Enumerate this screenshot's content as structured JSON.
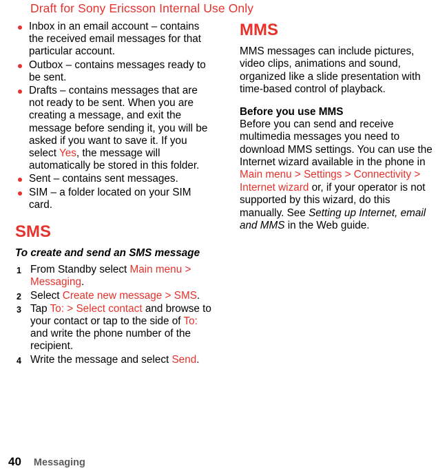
{
  "header": {
    "draft_notice": "Draft for Sony Ericsson Internal Use Only"
  },
  "left_column": {
    "bullets": [
      {
        "parts": [
          {
            "t": "Inbox in an email account – contains the received email messages for that particular account.",
            "s": "plain"
          }
        ]
      },
      {
        "parts": [
          {
            "t": "Outbox – contains messages ready to be sent.",
            "s": "plain"
          }
        ]
      },
      {
        "parts": [
          {
            "t": "Drafts – contains messages that are not ready to be sent. When you are creating a message, and exit the message before sending it, you will be asked if you want to save it. If you select ",
            "s": "plain"
          },
          {
            "t": "Yes",
            "s": "red"
          },
          {
            "t": ", the message will automatically be stored in this folder.",
            "s": "plain"
          }
        ]
      },
      {
        "parts": [
          {
            "t": "Sent – contains sent messages.",
            "s": "plain"
          }
        ]
      },
      {
        "parts": [
          {
            "t": "SIM – a folder located on your SIM card.",
            "s": "plain"
          }
        ]
      }
    ],
    "sms_heading": "SMS",
    "sms_subheading": "To create and send an SMS message",
    "steps": [
      {
        "parts": [
          {
            "t": "From Standby select ",
            "s": "plain"
          },
          {
            "t": "Main menu > Messaging",
            "s": "red"
          },
          {
            "t": ".",
            "s": "plain"
          }
        ]
      },
      {
        "parts": [
          {
            "t": "Select ",
            "s": "plain"
          },
          {
            "t": "Create new message > SMS",
            "s": "red"
          },
          {
            "t": ".",
            "s": "plain"
          }
        ]
      },
      {
        "parts": [
          {
            "t": "Tap ",
            "s": "plain"
          },
          {
            "t": "To: > Select contact",
            "s": "red"
          },
          {
            "t": " and browse to your contact or tap to the side of ",
            "s": "plain"
          },
          {
            "t": "To:",
            "s": "red"
          },
          {
            "t": " and write the phone number of the recipient.",
            "s": "plain"
          }
        ]
      },
      {
        "parts": [
          {
            "t": "Write the message and select ",
            "s": "plain"
          },
          {
            "t": "Send",
            "s": "red"
          },
          {
            "t": ".",
            "s": "plain"
          }
        ]
      }
    ]
  },
  "right_column": {
    "mms_heading": "MMS",
    "mms_intro": "MMS messages can include pictures, video clips, animations and sound, organized like a slide presentation with time-based control of playback.",
    "before_heading": "Before you use MMS",
    "before_body": [
      {
        "t": "Before you can send and receive multimedia messages you need to download MMS settings. You can use the Internet wizard available in the phone in ",
        "s": "plain"
      },
      {
        "t": "Main menu > Settings > Connectivity > Internet wizard",
        "s": "red"
      },
      {
        "t": " or, if your operator is not supported by this wizard, do this manually. See ",
        "s": "plain"
      },
      {
        "t": "Setting up Internet, email and MMS",
        "s": "ital"
      },
      {
        "t": " in the Web guide.",
        "s": "plain"
      }
    ]
  },
  "footer": {
    "page_number": "40",
    "chapter": "Messaging"
  }
}
